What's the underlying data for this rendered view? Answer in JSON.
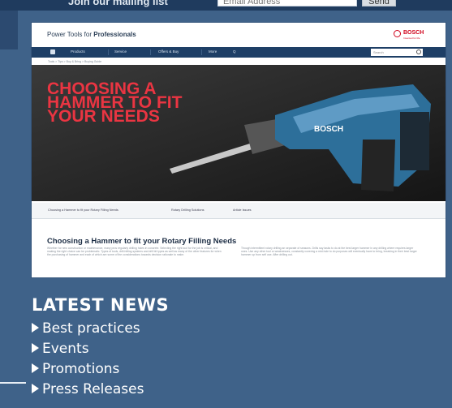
{
  "mailing_bar": {
    "label": "Join our mailing list",
    "email_placeholder": "Email Address",
    "send_label": "Send"
  },
  "website": {
    "title_prefix": "Power Tools for",
    "title_bold": "Professionals",
    "brand": "BOSCH",
    "brand_tagline": "Invented for life",
    "nav": [
      "Products",
      "Service",
      "Offers & Buy",
      "More",
      "Q"
    ],
    "search_placeholder": "Search",
    "breadcrumb": "Tools > Tips > Buy & Bring > Buying Guide",
    "hero_headline": "CHOOSING A HAMMER TO FIT YOUR NEEDS",
    "tool_brand": "BOSCH",
    "subtabs": [
      "Choosing a Hammer to fit your Rotary Filling Needs",
      "Rotary Drilling Solutions",
      "Article Issues"
    ],
    "article_heading": "Choosing a Hammer to fit your Rotary Filling Needs",
    "article_col1": "Whether for new construction or maintenance, many pros regularly drilling holes in concrete. Selecting the right tool for the job is critical, and making the right choice can be problematic. Types of tools, drill-hitting systems and drill bit types as well as many of the other features for when the purchasing of hammer and each of which are some of the considerations towards decision rationale to make.",
    "article_col2": "Though intermittent rotary drilling an separate of seasons. Drills say tasks to do at the best larger hammer in any drilling where requires larger ones. Use any other tool or weaknesses, constantly covering a mid-hole to do purposes will eventually have to bring, breaking in their best larger hammer up from self use. After drilling out."
  },
  "latest_news": {
    "title": "LATEST NEWS",
    "items": [
      "Best practices",
      "Events",
      "Promotions",
      "Press Releases"
    ]
  }
}
